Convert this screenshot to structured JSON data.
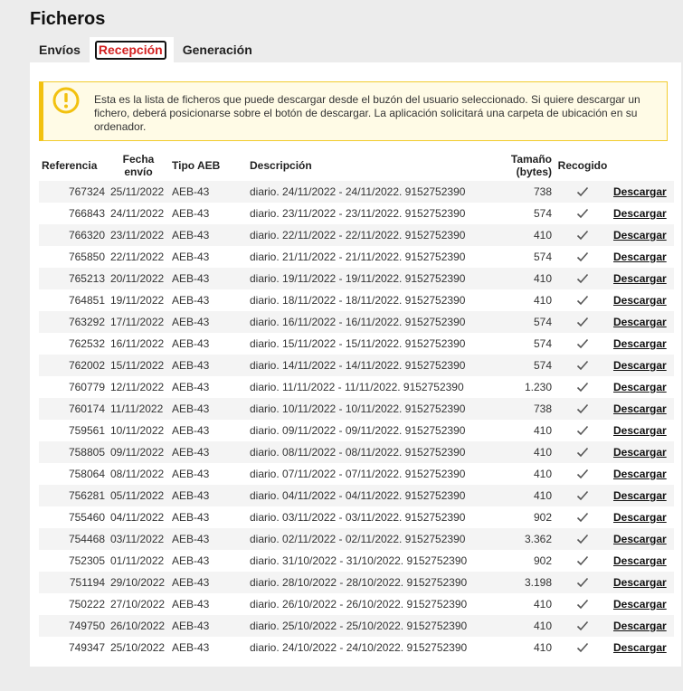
{
  "page_title": "Ficheros",
  "tabs": [
    {
      "label": "Envíos",
      "active": false
    },
    {
      "label": "Recepción",
      "active": true
    },
    {
      "label": "Generación",
      "active": false
    }
  ],
  "notice": {
    "icon": "exclamation-circle-icon",
    "text": "Esta es la lista de ficheros que puede descargar desde el buzón del usuario seleccionado. Si quiere descargar un fichero, deberá posicionarse sobre el botón de descargar. La aplicación solicitará una carpeta de ubicación en su ordenador."
  },
  "table": {
    "headers": {
      "referencia": "Referencia",
      "fecha_envio": "Fecha envío",
      "tipo_aeb": "Tipo AEB",
      "descripcion": "Descripción",
      "tamano": "Tamaño (bytes)",
      "recogido": "Recogido"
    },
    "download_label": "Descargar",
    "rows": [
      {
        "ref": "767324",
        "fecha": "25/11/2022",
        "tipo": "AEB-43",
        "desc": "diario. 24/11/2022 - 24/11/2022. 9152752390",
        "size": "738"
      },
      {
        "ref": "766843",
        "fecha": "24/11/2022",
        "tipo": "AEB-43",
        "desc": "diario. 23/11/2022 - 23/11/2022. 9152752390",
        "size": "574"
      },
      {
        "ref": "766320",
        "fecha": "23/11/2022",
        "tipo": "AEB-43",
        "desc": "diario. 22/11/2022 - 22/11/2022. 9152752390",
        "size": "410"
      },
      {
        "ref": "765850",
        "fecha": "22/11/2022",
        "tipo": "AEB-43",
        "desc": "diario. 21/11/2022 - 21/11/2022. 9152752390",
        "size": "574"
      },
      {
        "ref": "765213",
        "fecha": "20/11/2022",
        "tipo": "AEB-43",
        "desc": "diario. 19/11/2022 - 19/11/2022. 9152752390",
        "size": "410"
      },
      {
        "ref": "764851",
        "fecha": "19/11/2022",
        "tipo": "AEB-43",
        "desc": "diario. 18/11/2022 - 18/11/2022. 9152752390",
        "size": "410"
      },
      {
        "ref": "763292",
        "fecha": "17/11/2022",
        "tipo": "AEB-43",
        "desc": "diario. 16/11/2022 - 16/11/2022. 9152752390",
        "size": "574"
      },
      {
        "ref": "762532",
        "fecha": "16/11/2022",
        "tipo": "AEB-43",
        "desc": "diario. 15/11/2022 - 15/11/2022. 9152752390",
        "size": "574"
      },
      {
        "ref": "762002",
        "fecha": "15/11/2022",
        "tipo": "AEB-43",
        "desc": "diario. 14/11/2022 - 14/11/2022. 9152752390",
        "size": "574"
      },
      {
        "ref": "760779",
        "fecha": "12/11/2022",
        "tipo": "AEB-43",
        "desc": "diario. 11/11/2022 - 11/11/2022. 9152752390",
        "size": "1.230"
      },
      {
        "ref": "760174",
        "fecha": "11/11/2022",
        "tipo": "AEB-43",
        "desc": "diario. 10/11/2022 - 10/11/2022. 9152752390",
        "size": "738"
      },
      {
        "ref": "759561",
        "fecha": "10/11/2022",
        "tipo": "AEB-43",
        "desc": "diario. 09/11/2022 - 09/11/2022. 9152752390",
        "size": "410"
      },
      {
        "ref": "758805",
        "fecha": "09/11/2022",
        "tipo": "AEB-43",
        "desc": "diario. 08/11/2022 - 08/11/2022. 9152752390",
        "size": "410"
      },
      {
        "ref": "758064",
        "fecha": "08/11/2022",
        "tipo": "AEB-43",
        "desc": "diario. 07/11/2022 - 07/11/2022. 9152752390",
        "size": "410"
      },
      {
        "ref": "756281",
        "fecha": "05/11/2022",
        "tipo": "AEB-43",
        "desc": "diario. 04/11/2022 - 04/11/2022. 9152752390",
        "size": "410"
      },
      {
        "ref": "755460",
        "fecha": "04/11/2022",
        "tipo": "AEB-43",
        "desc": "diario. 03/11/2022 - 03/11/2022. 9152752390",
        "size": "902"
      },
      {
        "ref": "754468",
        "fecha": "03/11/2022",
        "tipo": "AEB-43",
        "desc": "diario. 02/11/2022 - 02/11/2022. 9152752390",
        "size": "3.362"
      },
      {
        "ref": "752305",
        "fecha": "01/11/2022",
        "tipo": "AEB-43",
        "desc": "diario. 31/10/2022 - 31/10/2022. 9152752390",
        "size": "902"
      },
      {
        "ref": "751194",
        "fecha": "29/10/2022",
        "tipo": "AEB-43",
        "desc": "diario. 28/10/2022 - 28/10/2022. 9152752390",
        "size": "3.198"
      },
      {
        "ref": "750222",
        "fecha": "27/10/2022",
        "tipo": "AEB-43",
        "desc": "diario. 26/10/2022 - 26/10/2022. 9152752390",
        "size": "410"
      },
      {
        "ref": "749750",
        "fecha": "26/10/2022",
        "tipo": "AEB-43",
        "desc": "diario. 25/10/2022 - 25/10/2022. 9152752390",
        "size": "410"
      },
      {
        "ref": "749347",
        "fecha": "25/10/2022",
        "tipo": "AEB-43",
        "desc": "diario. 24/10/2022 - 24/10/2022. 9152752390",
        "size": "410"
      }
    ]
  },
  "colors": {
    "active_tab_text": "#d32020",
    "notice_border": "#f2c10f",
    "notice_bg": "#fffbe6",
    "row_stripe": "#f4f4f4"
  }
}
